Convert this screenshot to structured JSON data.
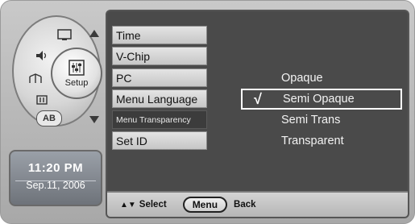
{
  "left_pod": {
    "setup_label": "Setup",
    "icons": [
      "screen-icon",
      "speaker-icon",
      "antenna-icon",
      "parental-icon",
      "ab-language-icon"
    ],
    "ab_label": "AB"
  },
  "clock": {
    "time": "11:20 PM",
    "date": "Sep.11, 2006"
  },
  "menu": {
    "items": [
      {
        "label": "Time"
      },
      {
        "label": "V-Chip"
      },
      {
        "label": "PC"
      },
      {
        "label": "Menu Language"
      },
      {
        "label": "Menu Transparency"
      },
      {
        "label": "Set ID"
      }
    ],
    "selected_index": 4
  },
  "options": {
    "items": [
      "Opaque",
      "Semi Opaque",
      "Semi Trans",
      "Transparent"
    ],
    "selected": "Semi Opaque",
    "check_glyph": "√"
  },
  "footer": {
    "nav_glyph": "▲▼",
    "select_label": "Select",
    "menu_label": "Menu",
    "back_label": "Back"
  }
}
